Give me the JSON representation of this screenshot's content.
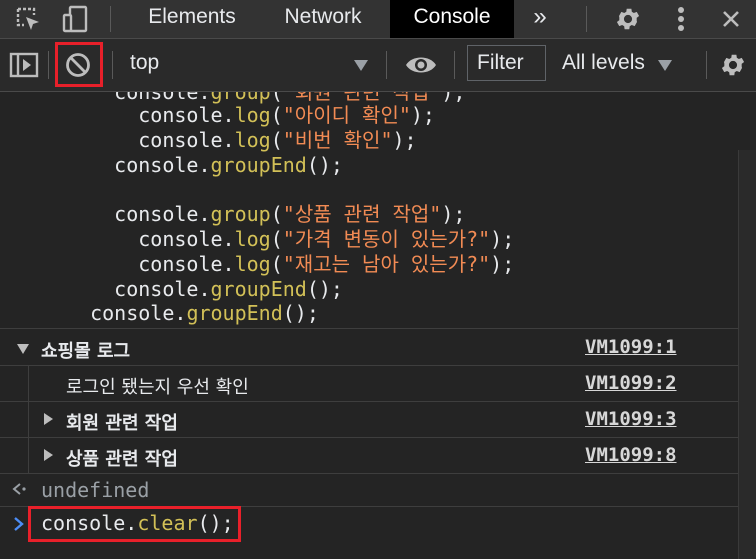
{
  "tabs": {
    "elements": "Elements",
    "network": "Network",
    "console": "Console",
    "more": "»"
  },
  "toolbar": {
    "context": "top",
    "filter": "Filter",
    "levels": "All levels"
  },
  "code_lines": [
    {
      "indent": "    ",
      "obj": "console",
      "fn": "group",
      "str": "\"회원 관련 작업\"",
      "end": ");"
    },
    {
      "indent": "      ",
      "obj": "console",
      "fn": "log",
      "str": "\"아이디 확인\"",
      "end": ");"
    },
    {
      "indent": "      ",
      "obj": "console",
      "fn": "log",
      "str": "\"비번 확인\"",
      "end": ");"
    },
    {
      "indent": "    ",
      "obj": "console",
      "fn": "groupEnd",
      "str": "",
      "end": "();"
    },
    {
      "indent": "",
      "obj": "",
      "fn": "",
      "str": "",
      "end": ""
    },
    {
      "indent": "    ",
      "obj": "console",
      "fn": "group",
      "str": "\"상품 관련 작업\"",
      "end": ");"
    },
    {
      "indent": "      ",
      "obj": "console",
      "fn": "log",
      "str": "\"가격 변동이 있는가?\"",
      "end": ");"
    },
    {
      "indent": "      ",
      "obj": "console",
      "fn": "log",
      "str": "\"재고는 남아 있는가?\"",
      "end": ");"
    },
    {
      "indent": "    ",
      "obj": "console",
      "fn": "groupEnd",
      "str": "",
      "end": "();"
    },
    {
      "indent": "  ",
      "obj": "console",
      "fn": "groupEnd",
      "str": "",
      "end": "();"
    }
  ],
  "messages": [
    {
      "text": "쇼핑몰 로그",
      "source": "VM1099:1"
    },
    {
      "text": "로그인 됐는지 우선 확인",
      "source": "VM1099:2"
    },
    {
      "text": "회원 관련 작업",
      "source": "VM1099:3"
    },
    {
      "text": "상품 관련 작업",
      "source": "VM1099:8"
    }
  ],
  "result": "undefined",
  "prompt": {
    "obj": "console",
    "fn": "clear",
    "end": "();"
  },
  "colors": {
    "string": "#f28b54",
    "function": "#d2c057",
    "highlight": "#e8202a",
    "prompt_arrow": "#4c8df6"
  }
}
